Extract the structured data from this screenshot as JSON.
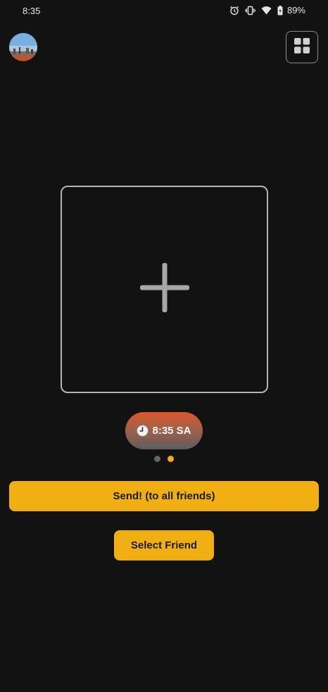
{
  "status_bar": {
    "time": "8:35",
    "battery_percent": "89%",
    "icons": [
      "alarm-icon",
      "vibrate-icon",
      "wifi-icon",
      "battery-icon"
    ]
  },
  "header": {
    "avatar_icon": "profile-avatar",
    "menu_icon": "grid-icon"
  },
  "photo_area": {
    "icon": "plus-icon"
  },
  "time_pill": {
    "icon": "clock-icon",
    "label": "8:35 SA"
  },
  "pager": {
    "count": 2,
    "active_index": 1,
    "active_color": "#f0b014",
    "inactive_color": "#5d6472"
  },
  "actions": {
    "send_label": "Send! (to all friends)",
    "select_friend_label": "Select Friend",
    "accent_color": "#efaf13"
  }
}
